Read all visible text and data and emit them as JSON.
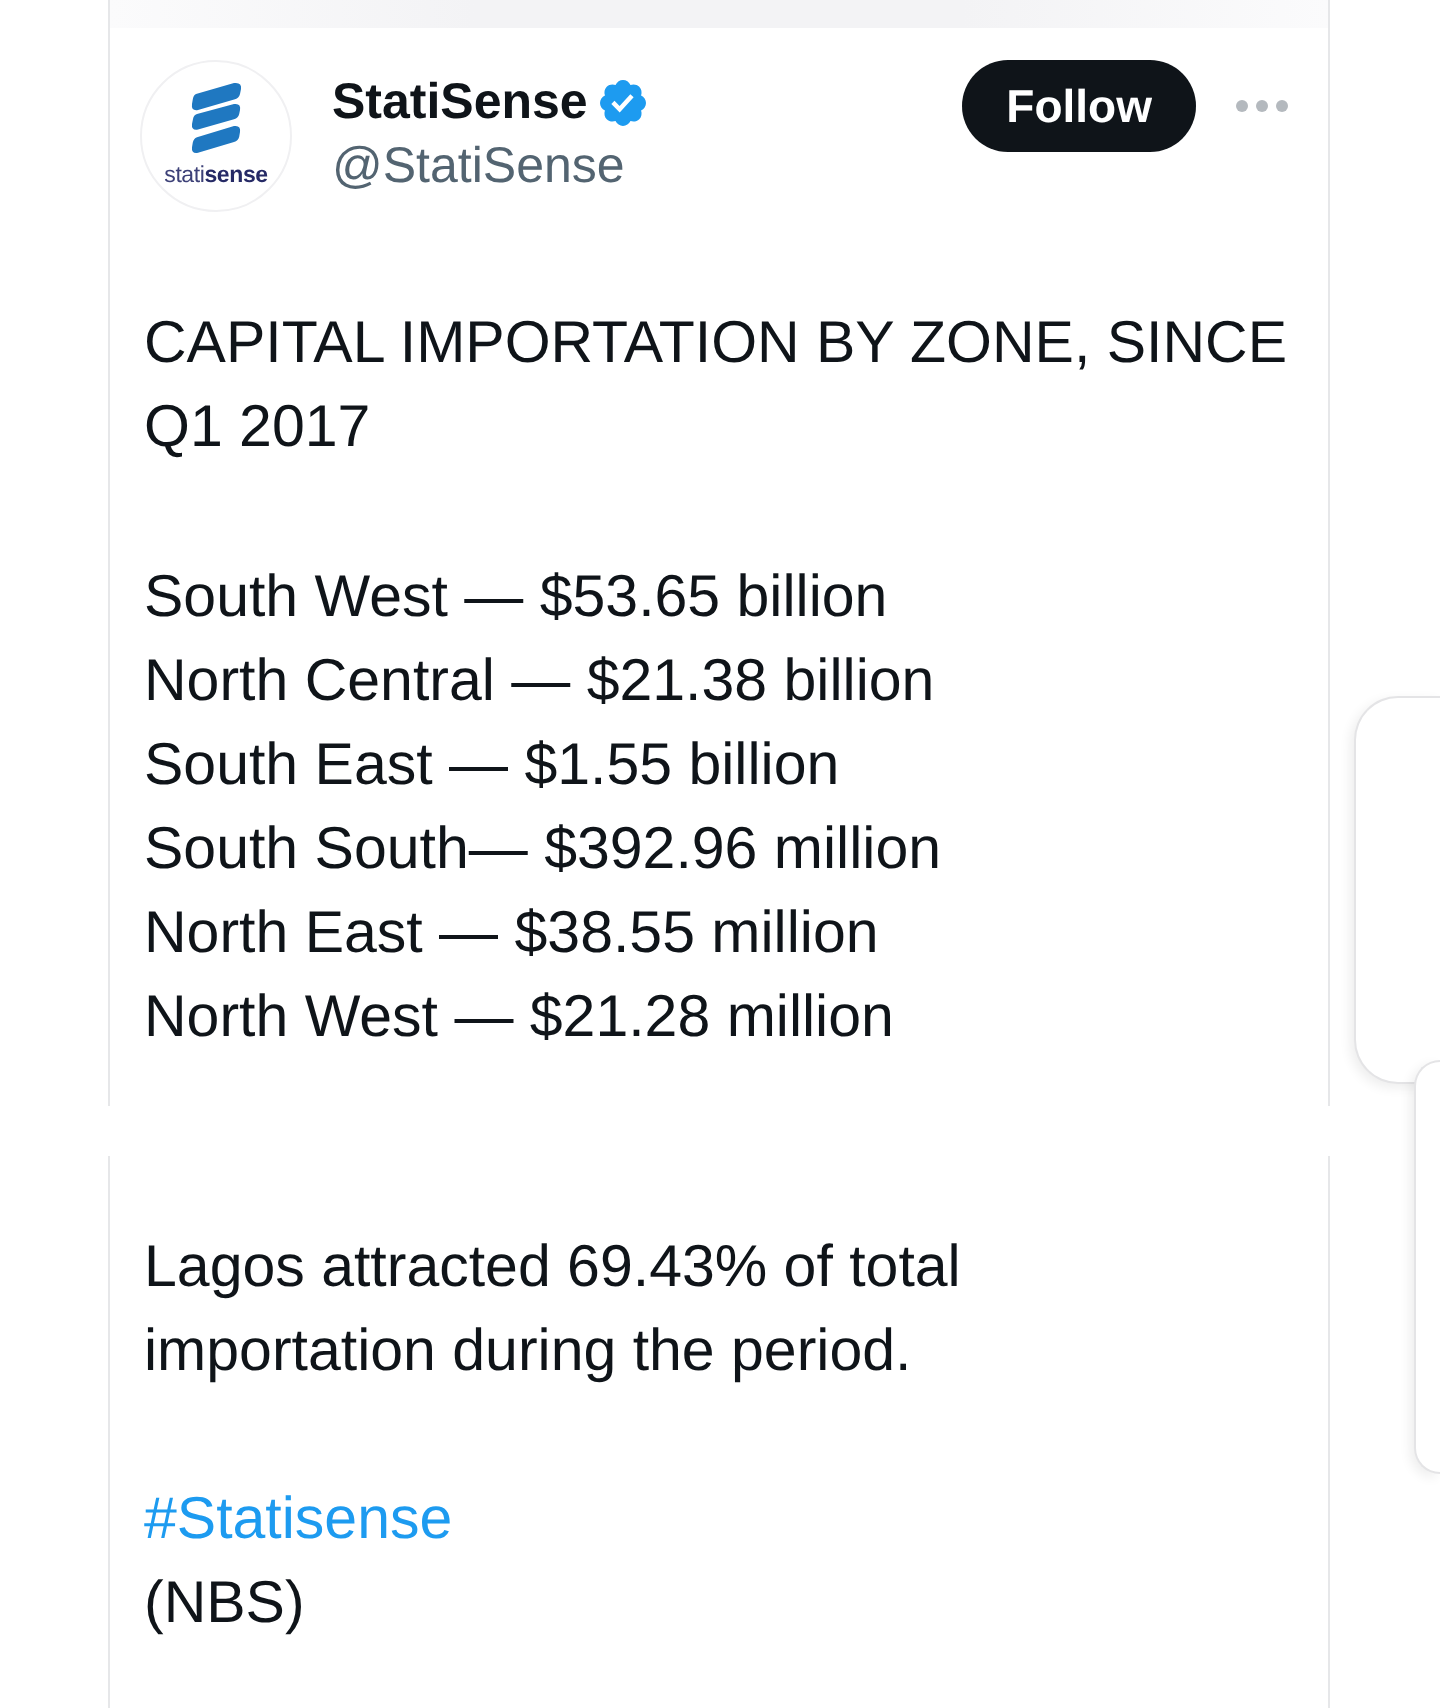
{
  "header": {
    "avatar": {
      "logo_text": "stati**sense**"
    },
    "name": "StatiSense",
    "verified": true,
    "handle": "@StatiSense",
    "follow_button": "Follow"
  },
  "post": {
    "title": "CAPITAL IMPORTATION BY ZONE, SINCE Q1 2017",
    "zones": [
      "South West — $53.65 billion",
      "North Central — $21.38 billion",
      "South East — $1.55 billion",
      "South South— $392.96 million",
      "North East — $38.55 million",
      "North West — $21.28 million"
    ],
    "summary": "Lagos attracted 69.43% of total importation during the period.",
    "hashtag": "#Statisense",
    "source": "(NBS)"
  }
}
